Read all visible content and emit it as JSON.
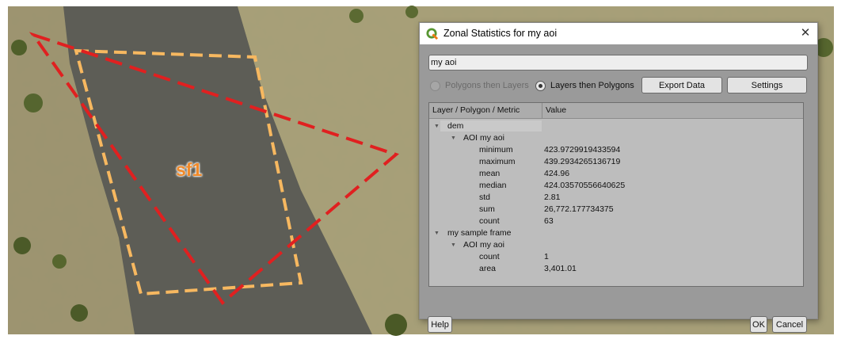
{
  "map": {
    "label": "sf1",
    "colors": {
      "triangle": "#e02020",
      "rectangle": "#f7b860",
      "river": "#5d5d56"
    }
  },
  "dialog": {
    "title": "Zonal Statistics for my aoi",
    "app_icon": "qgis-logo-icon",
    "close_icon": "close-icon",
    "name_field_value": "my aoi",
    "radio_polygons_then_layers": {
      "label": "Polygons then Layers",
      "selected": false,
      "enabled": false
    },
    "radio_layers_then_polygons": {
      "label": "Layers then Polygons",
      "selected": true,
      "enabled": true
    },
    "export_button": "Export Data",
    "settings_button": "Settings",
    "tree": {
      "headers": [
        "Layer / Polygon / Metric",
        "Value"
      ],
      "layers": [
        {
          "name": "dem",
          "polygons": [
            {
              "name": "AOI my aoi",
              "metrics": [
                {
                  "metric": "minimum",
                  "value": "423.9729919433594"
                },
                {
                  "metric": "maximum",
                  "value": "439.2934265136719"
                },
                {
                  "metric": "mean",
                  "value": "424.96"
                },
                {
                  "metric": "median",
                  "value": "424.03570556640625"
                },
                {
                  "metric": "std",
                  "value": "2.81"
                },
                {
                  "metric": "sum",
                  "value": "26,772.177734375"
                },
                {
                  "metric": "count",
                  "value": "63"
                }
              ]
            }
          ]
        },
        {
          "name": "my sample frame",
          "polygons": [
            {
              "name": "AOI my aoi",
              "metrics": [
                {
                  "metric": "count",
                  "value": "1"
                },
                {
                  "metric": "area",
                  "value": "3,401.01"
                }
              ]
            }
          ]
        }
      ]
    },
    "help_button": "Help",
    "ok_button": "OK",
    "cancel_button": "Cancel"
  }
}
